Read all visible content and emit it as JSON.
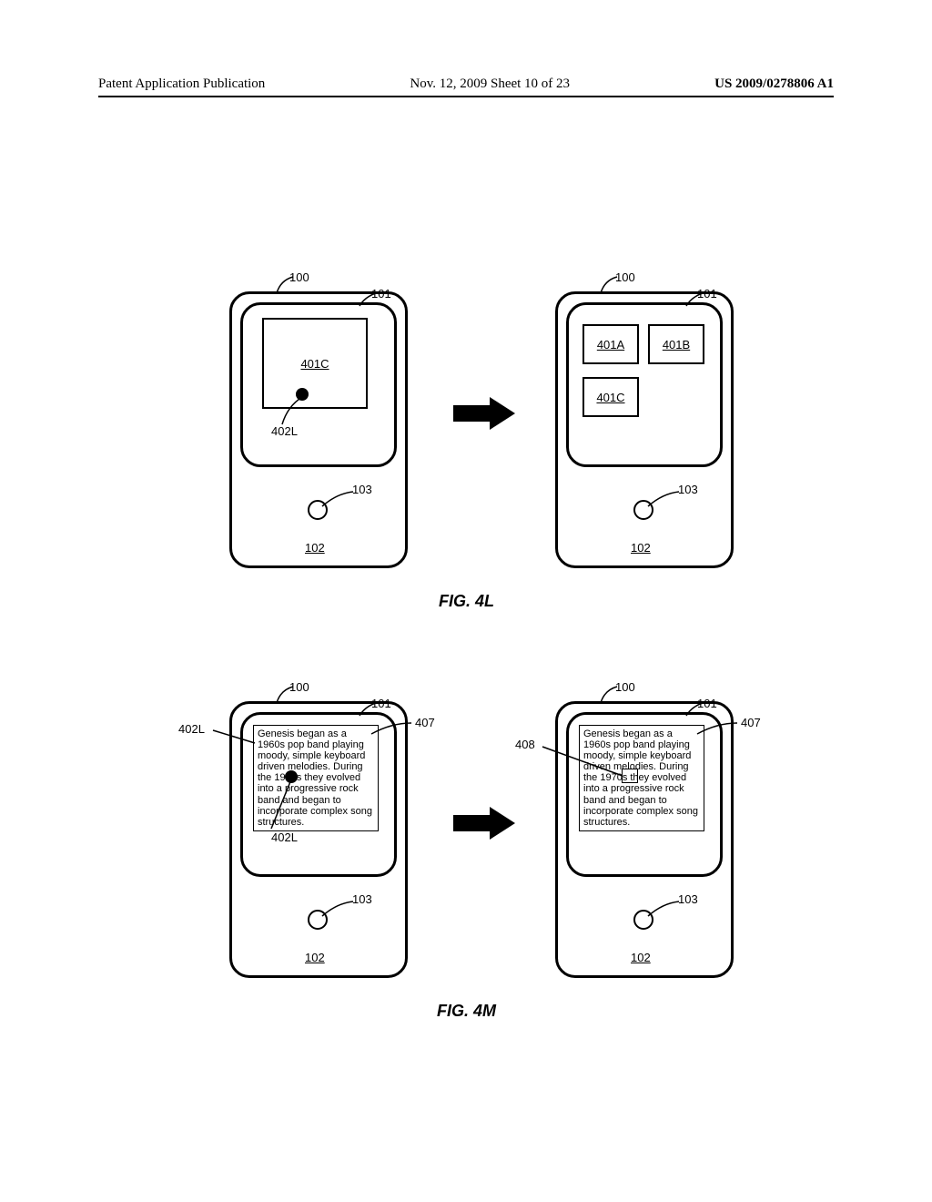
{
  "header": {
    "left": "Patent Application Publication",
    "center": "Nov. 12, 2009  Sheet 10 of 23",
    "right": "US 2009/0278806 A1"
  },
  "labels": {
    "n100": "100",
    "n101": "101",
    "n102": "102",
    "n103": "103",
    "n401A": "401A",
    "n401B": "401B",
    "n401C": "401C",
    "n402L": "402L",
    "n407": "407",
    "n408": "408"
  },
  "captions": {
    "fig4L": "FIG. 4L",
    "fig4M": "FIG. 4M"
  },
  "paragraph": "Genesis began as a 1960s pop band playing moody, simple keyboard driven melodies. During the 1970s they evolved into a progressive rock band and began to incorporate complex song structures."
}
